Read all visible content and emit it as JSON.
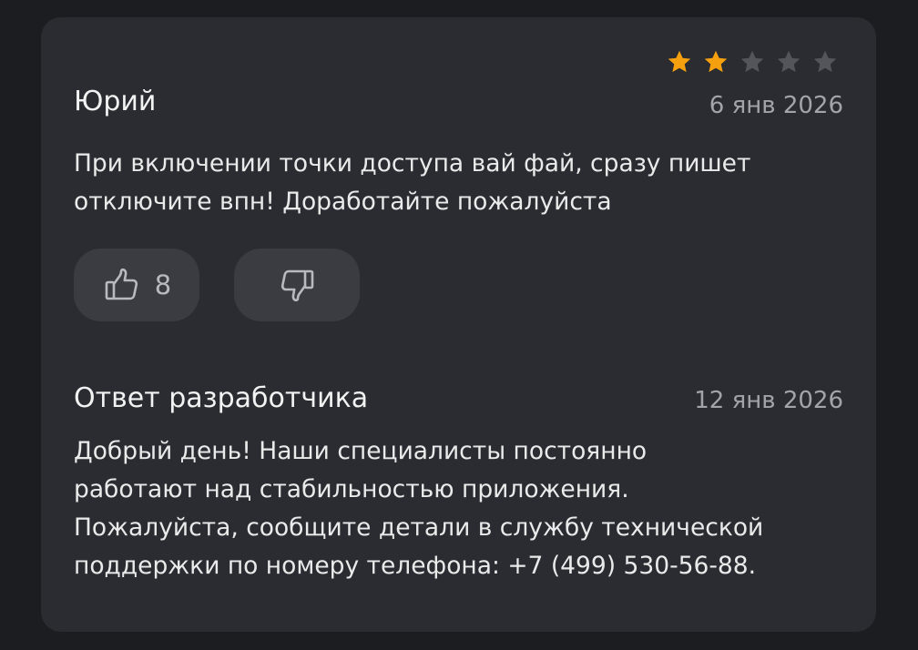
{
  "review": {
    "rating": 2,
    "max_rating": 5,
    "author": "Юрий",
    "date": "6 янв 2026",
    "text_line1": "При включении точки доступа вай фай, сразу пишет",
    "text_line2": "отключите впн! Доработайте пожалуйста",
    "likes": "8"
  },
  "reply": {
    "title": "Ответ разработчика",
    "date": "12 янв 2026",
    "text_line1": "Добрый день! Наши специалисты постоянно",
    "text_line2": "работают над стабильностью приложения.",
    "text_line3": "Пожалуйста, сообщите детали в службу технической",
    "text_line4": "поддержки по номеру телефона: +7 (499) 530-56-88."
  },
  "colors": {
    "star_filled": "#f5a00f",
    "star_empty": "#54555a",
    "card_bg": "#2b2c31",
    "page_bg": "#1c1d21"
  },
  "icons": {
    "like": "thumbs-up-icon",
    "dislike": "thumbs-down-icon",
    "star": "star-icon"
  }
}
